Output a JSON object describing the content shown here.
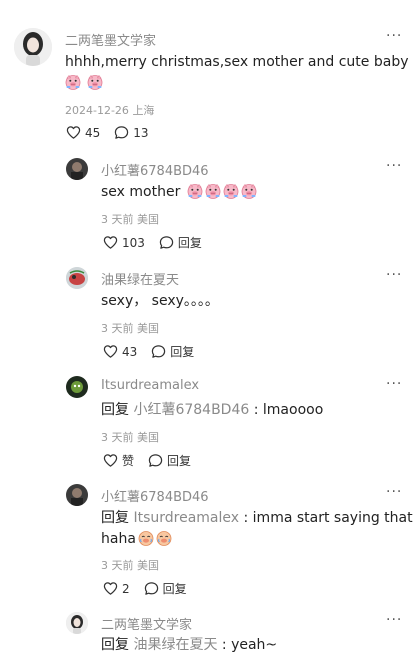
{
  "main_comment": {
    "user": "二两笔墨文学家",
    "text": "hhhh,merry christmas,sex mother and cute baby",
    "emojis": [
      "pig-face-emoji",
      "pig-face-emoji"
    ],
    "date": "2024-12-26",
    "location": "上海",
    "likes": "45",
    "replies": "13"
  },
  "replies": [
    {
      "user": "小红薯6784BD46",
      "text": "sex mother",
      "emojis": [
        "pig-face-emoji",
        "pig-face-emoji",
        "pig-face-emoji",
        "pig-face-emoji"
      ],
      "time": "3 天前",
      "location": "美国",
      "likes": "103",
      "reply_label": "回复"
    },
    {
      "user": "油果绿在夏天",
      "text": "sexy， sexy。。。。",
      "time": "3 天前",
      "location": "美国",
      "likes": "43",
      "reply_label": "回复"
    },
    {
      "user": "Itsurdreamalex",
      "reply_prefix": "回复",
      "reply_target": "小红薯6784BD46",
      "text": " : lmaoooo",
      "time": "3 天前",
      "location": "美国",
      "likes": "赞",
      "reply_label": "回复"
    },
    {
      "user": "小红薯6784BD46",
      "reply_prefix": "回复",
      "reply_target": "Itsurdreamalex",
      "text": " : imma start saying that",
      "text_line2": "haha",
      "emojis": [
        "laughing-pig-emoji",
        "laughing-pig-emoji"
      ],
      "time": "3 天前",
      "location": "美国",
      "likes": "2",
      "reply_label": "回复"
    },
    {
      "user": "二两笔墨文学家",
      "reply_prefix": "回复",
      "reply_target": "油果绿在夏天",
      "text": " : yeah~"
    }
  ],
  "more_glyph": "···"
}
